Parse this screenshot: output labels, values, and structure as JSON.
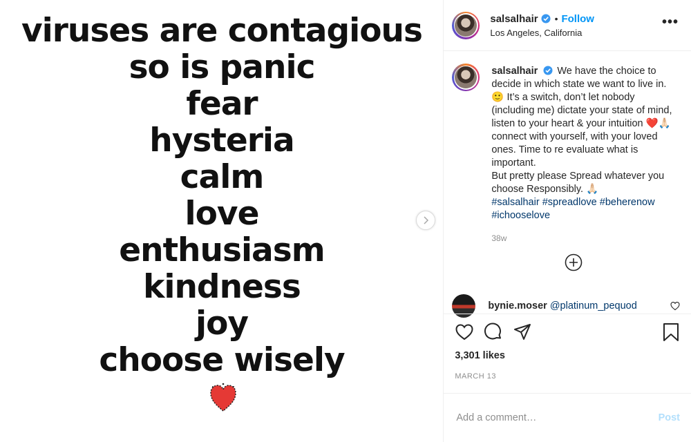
{
  "poster": {
    "lines": [
      "viruses are contagious",
      "so is panic",
      "fear",
      "hysteria",
      "calm",
      "love",
      "enthusiasm",
      "kindness",
      "joy",
      "choose wisely"
    ],
    "heart_color": "#e53935"
  },
  "header": {
    "username": "salsalhair",
    "separator": "•",
    "follow_label": "Follow",
    "location": "Los Angeles, California",
    "more_label": "•••"
  },
  "caption": {
    "username": "salsalhair",
    "paragraph1": "We have the choice to decide in which state we want to live in. 🙂 It’s a switch, don’t let nobody (including me) dictate your state of mind, listen to your heart & your intuition ❤️🙏🏻 connect with yourself, with your loved ones. Time to re evaluate what is important.",
    "paragraph2": "But pretty please Spread whatever you choose Responsibly. 🙏🏻",
    "hashtags": [
      "#salsalhair",
      "#spreadlove",
      "#beherenow",
      "#ichooselove"
    ],
    "time": "38w"
  },
  "comment": {
    "username": "bynie.moser",
    "mention": "@platinum_pequod"
  },
  "actions": {
    "likes": "3,301 likes",
    "date": "MARCH 13"
  },
  "add_comment": {
    "placeholder": "Add a comment…",
    "post_label": "Post"
  },
  "colors": {
    "accent": "#0095f6",
    "link": "#00376b",
    "post_disabled": "#b2dffc"
  }
}
